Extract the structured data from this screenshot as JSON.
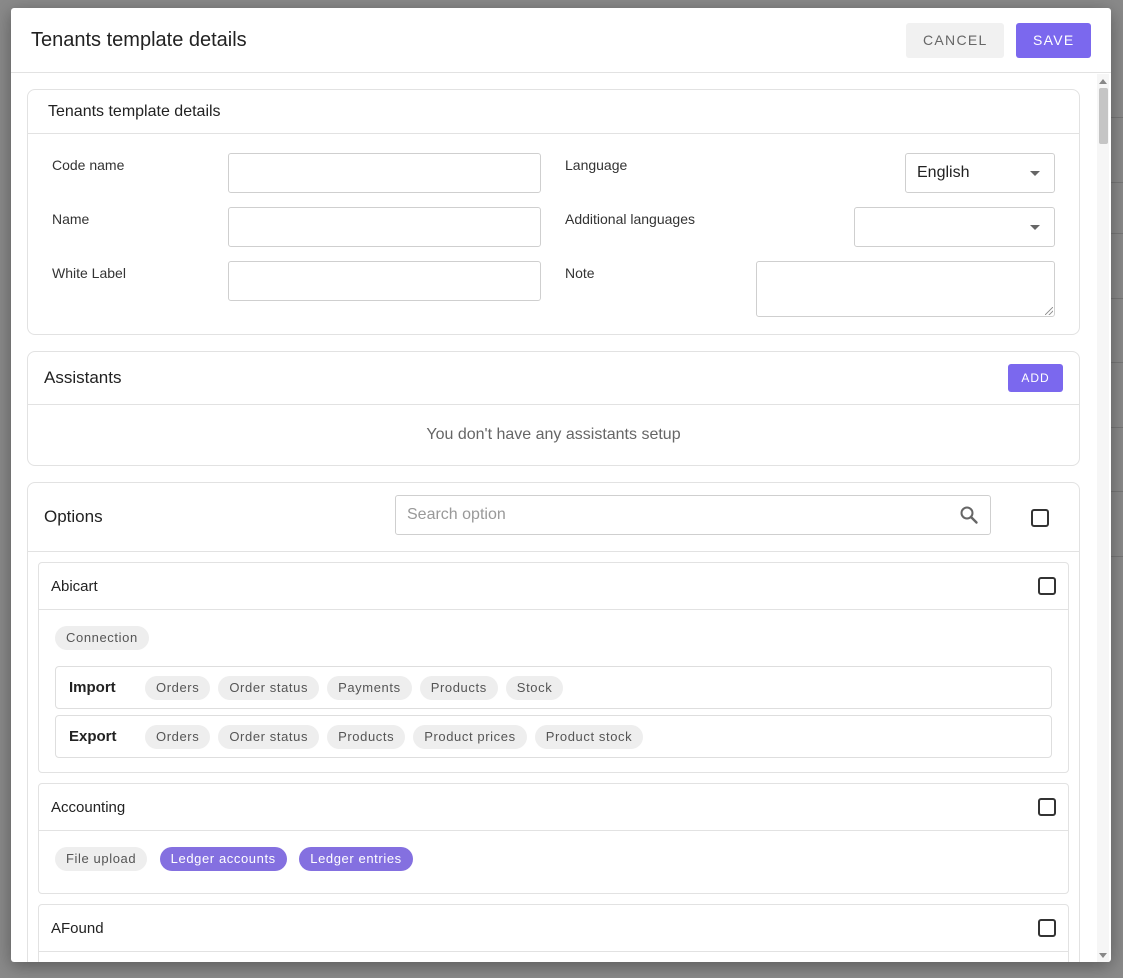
{
  "modal": {
    "title": "Tenants template details",
    "cancel_label": "CANCEL",
    "save_label": "SAVE"
  },
  "details": {
    "title": "Tenants template details",
    "code_name_label": "Code name",
    "code_name_value": "",
    "name_label": "Name",
    "name_value": "",
    "white_label_label": "White Label",
    "white_label_value": "",
    "language_label": "Language",
    "language_value": "English",
    "additional_languages_label": "Additional languages",
    "additional_languages_value": "",
    "note_label": "Note",
    "note_value": ""
  },
  "assistants": {
    "title": "Assistants",
    "add_label": "ADD",
    "empty_message": "You don't have any assistants setup"
  },
  "options": {
    "title": "Options",
    "search_placeholder": "Search option",
    "groups": [
      {
        "name": "Abicart",
        "top_chips": [
          "Connection"
        ],
        "rows": [
          {
            "label": "Import",
            "chips": [
              "Orders",
              "Order status",
              "Payments",
              "Products",
              "Stock"
            ]
          },
          {
            "label": "Export",
            "chips": [
              "Orders",
              "Order status",
              "Products",
              "Product prices",
              "Product stock"
            ]
          }
        ]
      },
      {
        "name": "Accounting",
        "top_chips": [
          "File upload",
          "Ledger accounts",
          "Ledger entries"
        ],
        "selected_chips": [
          "Ledger accounts",
          "Ledger entries"
        ]
      },
      {
        "name": "AFound"
      }
    ]
  },
  "colors": {
    "accent": "#7b68ee",
    "chip_selected": "#8470e0",
    "chip_default": "#eeeeee"
  }
}
